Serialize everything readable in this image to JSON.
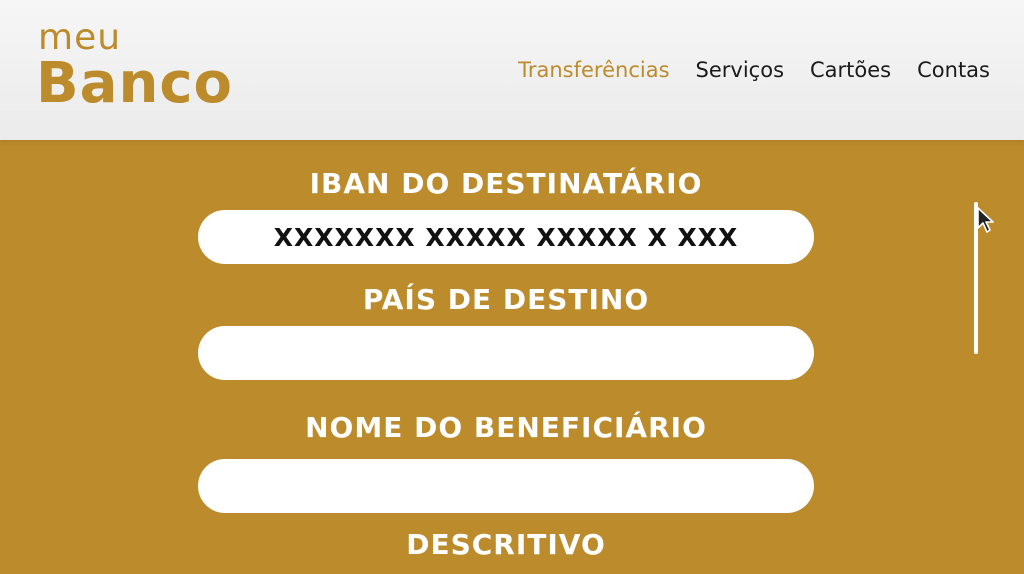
{
  "logo": {
    "top": "meu",
    "bottom": "Banco"
  },
  "nav": [
    {
      "label": "Transferências",
      "active": true
    },
    {
      "label": "Serviços",
      "active": false
    },
    {
      "label": "Cartões",
      "active": false
    },
    {
      "label": "Contas",
      "active": false
    }
  ],
  "form": {
    "iban": {
      "label": "IBAN DO DESTINATÁRIO",
      "value": "XXXXXXX XXXXX XXXXX X XXX"
    },
    "country": {
      "label": "PAÍS DE DESTINO",
      "value": ""
    },
    "beneficiary": {
      "label": "NOME DO BENEFICIÁRIO",
      "value": ""
    },
    "description": {
      "label": "DESCRITIVO"
    }
  },
  "colors": {
    "accent": "#bc8b2b",
    "header_bg": "#f0f0f0",
    "text_dark": "#1b1b1b",
    "input_bg": "#ffffff"
  },
  "icons": {
    "cursor": "mouse-pointer-icon"
  }
}
